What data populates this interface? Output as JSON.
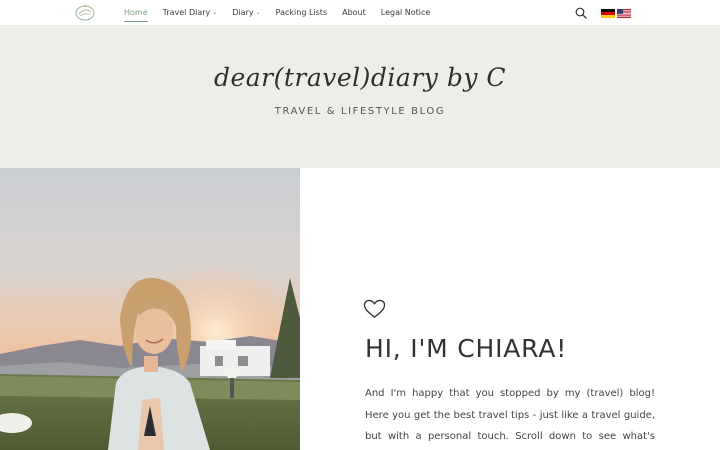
{
  "nav": {
    "logo_icon": "compass-logo-icon",
    "items": [
      {
        "label": "Home",
        "active": true,
        "dropdown": false
      },
      {
        "label": "Travel Diary",
        "active": false,
        "dropdown": true
      },
      {
        "label": "Diary",
        "active": false,
        "dropdown": true
      },
      {
        "label": "Packing Lists",
        "active": false,
        "dropdown": false
      },
      {
        "label": "About",
        "active": false,
        "dropdown": false
      },
      {
        "label": "Legal Notice",
        "active": false,
        "dropdown": false
      }
    ],
    "dropdown_glyph": "⌄",
    "search_icon": "search-icon",
    "languages": [
      "german-flag-icon",
      "us-flag-icon"
    ],
    "active_color": "#7aa287"
  },
  "hero": {
    "title": "dear(travel)diary by C",
    "tagline": "TRAVEL & LIFESTYLE BLOG",
    "background": "#efedea"
  },
  "intro": {
    "icon": "heart-icon",
    "heading": "HI, I'M CHIARA!",
    "text": "And I'm happy that you stopped by my (travel) blog! Here you get the best travel tips - just like a travel guide, but with a personal touch. Scroll down to see what's there to discover."
  }
}
